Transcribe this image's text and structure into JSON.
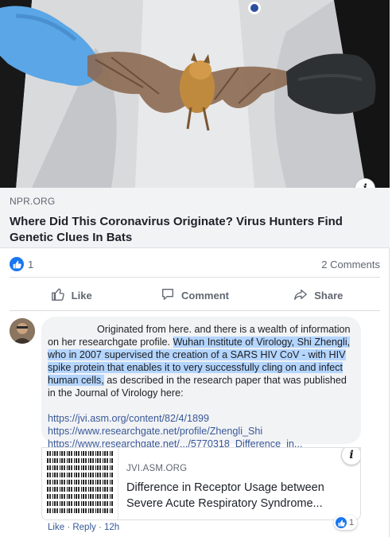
{
  "post": {
    "hero_image": "bat-held-by-researcher-in-protective-suit",
    "link_domain": "NPR.ORG",
    "link_title": "Where Did This Coronavirus Originate? Virus Hunters Find Genetic Clues In Bats",
    "info_icon": "i"
  },
  "stats": {
    "like_count": "1",
    "comments": "2 Comments"
  },
  "actions": {
    "like": "Like",
    "comment": "Comment",
    "share": "Share"
  },
  "comment": {
    "text_before": "Originated from here. and there is a wealth of information on her researchgate profile.",
    "text_highlighted": "Wuhan Institute of Virology, Shi Zhengli, who in 2007 supervised the creation of a SARS HIV CoV - with HIV spike protein that enables it to very successfully cling on and infect human cells,",
    "text_after": "as described in the research paper that was published in the Journal of Virology here:",
    "links": [
      "https://jvi.asm.org/content/82/4/1899",
      "https://www.researchgate.net/profile/Zhengli_Shi",
      "https://www.researchgate.net/.../5770318_Difference_in..."
    ],
    "preview": {
      "domain": "JVI.ASM.ORG",
      "title": "Difference in Receptor Usage between Severe Acute Respiratory Syndrome...",
      "info_icon": "i"
    },
    "footer": {
      "like": "Like",
      "reply": "Reply",
      "time": "12h",
      "sep": "·"
    },
    "reaction_count": "1"
  },
  "colors": {
    "facebook_blue": "#1877f2",
    "link_blue": "#385898",
    "highlight": "#b4d5fe"
  }
}
